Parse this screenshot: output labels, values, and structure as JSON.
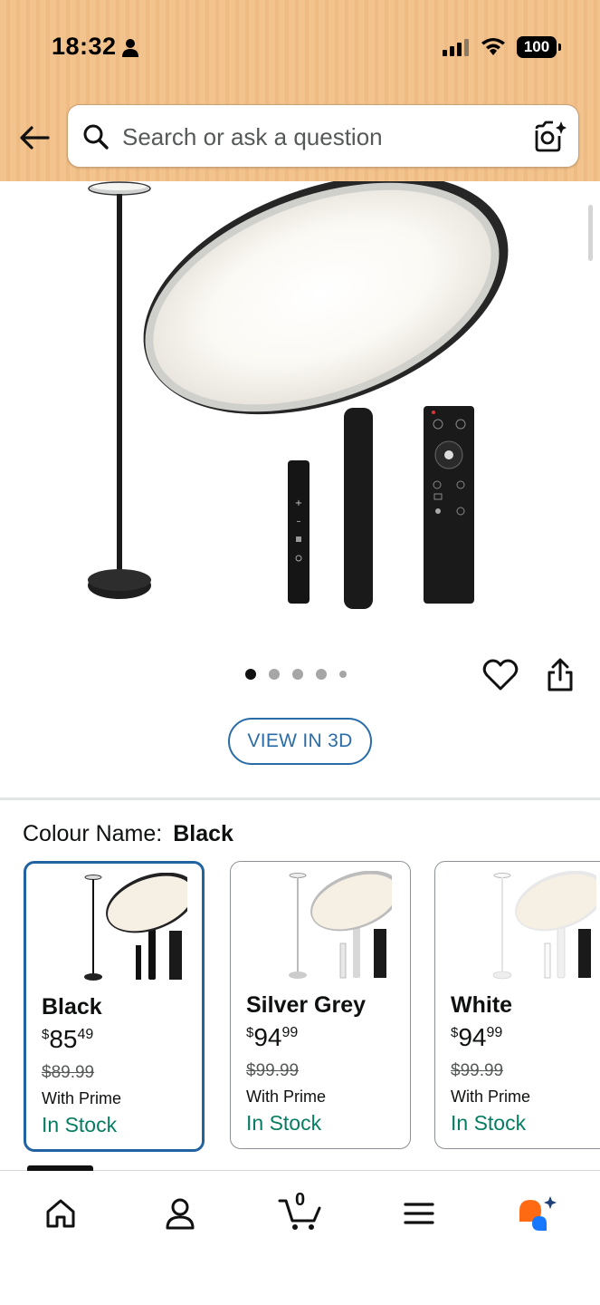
{
  "status_bar": {
    "time": "18:32",
    "battery": "100"
  },
  "search": {
    "placeholder": "Search or ask a question"
  },
  "gallery": {
    "image_count": 5,
    "active_index": 0,
    "view_3d_label": "VIEW IN 3D"
  },
  "colour": {
    "label": "Colour Name:",
    "selected": "Black"
  },
  "variants": [
    {
      "name": "Black",
      "currency": "$",
      "price_whole": "85",
      "price_cents": "49",
      "old_price": "$89.99",
      "prime": "With Prime",
      "stock": "In Stock"
    },
    {
      "name": "Silver Grey",
      "currency": "$",
      "price_whole": "94",
      "price_cents": "99",
      "old_price": "$99.99",
      "prime": "With Prime",
      "stock": "In Stock"
    },
    {
      "name": "White",
      "currency": "$",
      "price_whole": "94",
      "price_cents": "99",
      "old_price": "$99.99",
      "prime": "With Prime",
      "stock": "In Stock"
    }
  ],
  "bottom_nav": {
    "cart_count": "0",
    "items": [
      "home-icon",
      "account-icon",
      "cart-icon",
      "menu-icon",
      "rufus-icon"
    ]
  },
  "colors": {
    "header_bg": "#f3c38d",
    "accent_blue": "#2162a1",
    "stock_green": "#067d62"
  }
}
